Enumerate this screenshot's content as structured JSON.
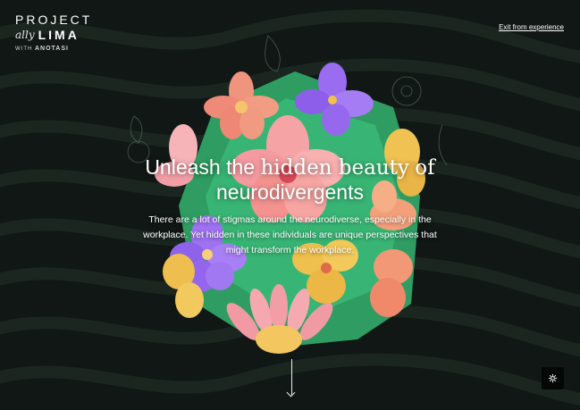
{
  "logo": {
    "project": "PROJECT",
    "ally": "ally",
    "lima": "LIMA",
    "with": "WITH",
    "brand": "ANOTASI"
  },
  "nav": {
    "exit_label": "Exit from experience"
  },
  "hero": {
    "headline_part1_sans": "Unleash the",
    "headline_part1_serif": "hidden beauty",
    "headline_part1_end": "of",
    "headline_line2": "neurodivergents",
    "subtitle": "There are a lot of stigmas around the neurodiverse, especially in the workplace. Yet hidden in these individuals are unique perspectives that might transform the workplace."
  },
  "icons": {
    "scroll": "arrow-down-icon",
    "settings": "settings-icon"
  },
  "colors": {
    "background": "#101714",
    "wave": "#17201c",
    "leaf": "#2f9d62",
    "pink": "#f08f8f",
    "purple": "#9b6bf0",
    "yellow": "#efc04e"
  }
}
